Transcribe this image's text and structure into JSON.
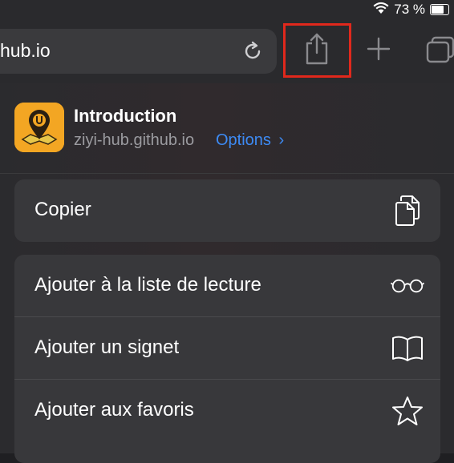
{
  "status_bar": {
    "battery": "73 %"
  },
  "toolbar": {
    "url_text": "hub.io"
  },
  "share_header": {
    "title": "Introduction",
    "domain": "ziyi-hub.github.io",
    "options_label": "Options",
    "options_chevron": "›"
  },
  "actions_group1": [
    {
      "label": "Copier",
      "icon": "copy-icon"
    }
  ],
  "actions_group2": [
    {
      "label": "Ajouter à la liste de lecture",
      "icon": "reading-glasses-icon"
    },
    {
      "label": "Ajouter un signet",
      "icon": "book-icon"
    },
    {
      "label": "Ajouter aux favoris",
      "icon": "star-icon"
    }
  ],
  "colors": {
    "accent": "#3d8bf5",
    "highlight": "#e0281c"
  }
}
